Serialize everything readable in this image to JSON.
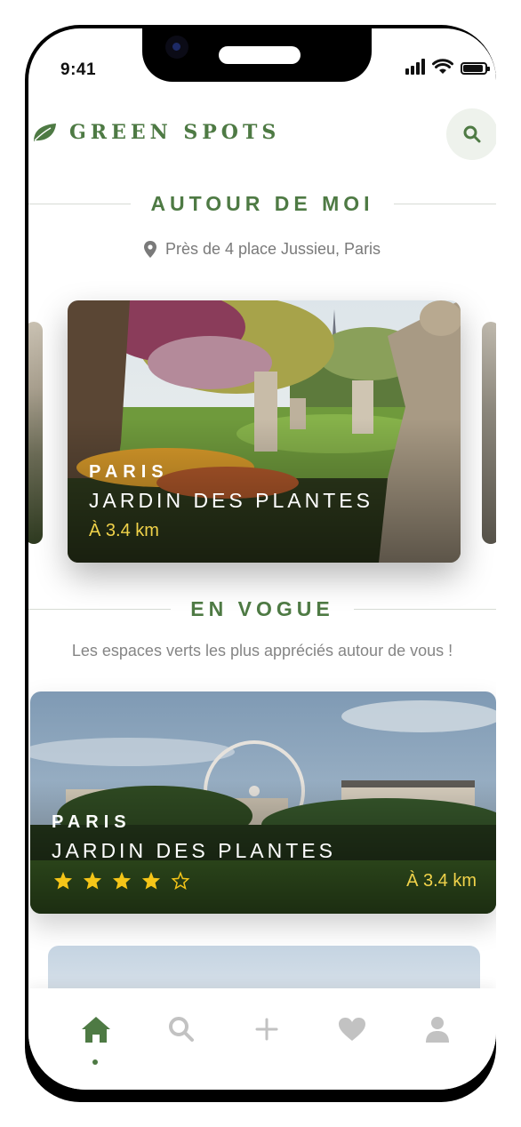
{
  "status_bar": {
    "time": "9:41"
  },
  "app": {
    "title": "GREEN SPOTS"
  },
  "nearby": {
    "title": "AUTOUR DE MOI",
    "location": "Près de 4 place Jussieu, Paris",
    "card": {
      "city": "PARIS",
      "name": "JARDIN DES PLANTES",
      "distance": "À 3.4 km"
    }
  },
  "trending": {
    "title": "EN VOGUE",
    "subtitle": "Les espaces verts les plus appréciés autour de vous !",
    "card": {
      "city": "PARIS",
      "name": "JARDIN DES PLANTES",
      "distance": "À 3.4 km",
      "rating": 4,
      "rating_max": 5
    }
  },
  "tab_bar": {
    "items": [
      "home-icon",
      "search-icon",
      "plus-icon",
      "heart-icon",
      "user-icon"
    ],
    "active": "home"
  },
  "colors": {
    "brand": "#4e7a44",
    "accent": "#f0d24a",
    "star": "#f5c518"
  }
}
